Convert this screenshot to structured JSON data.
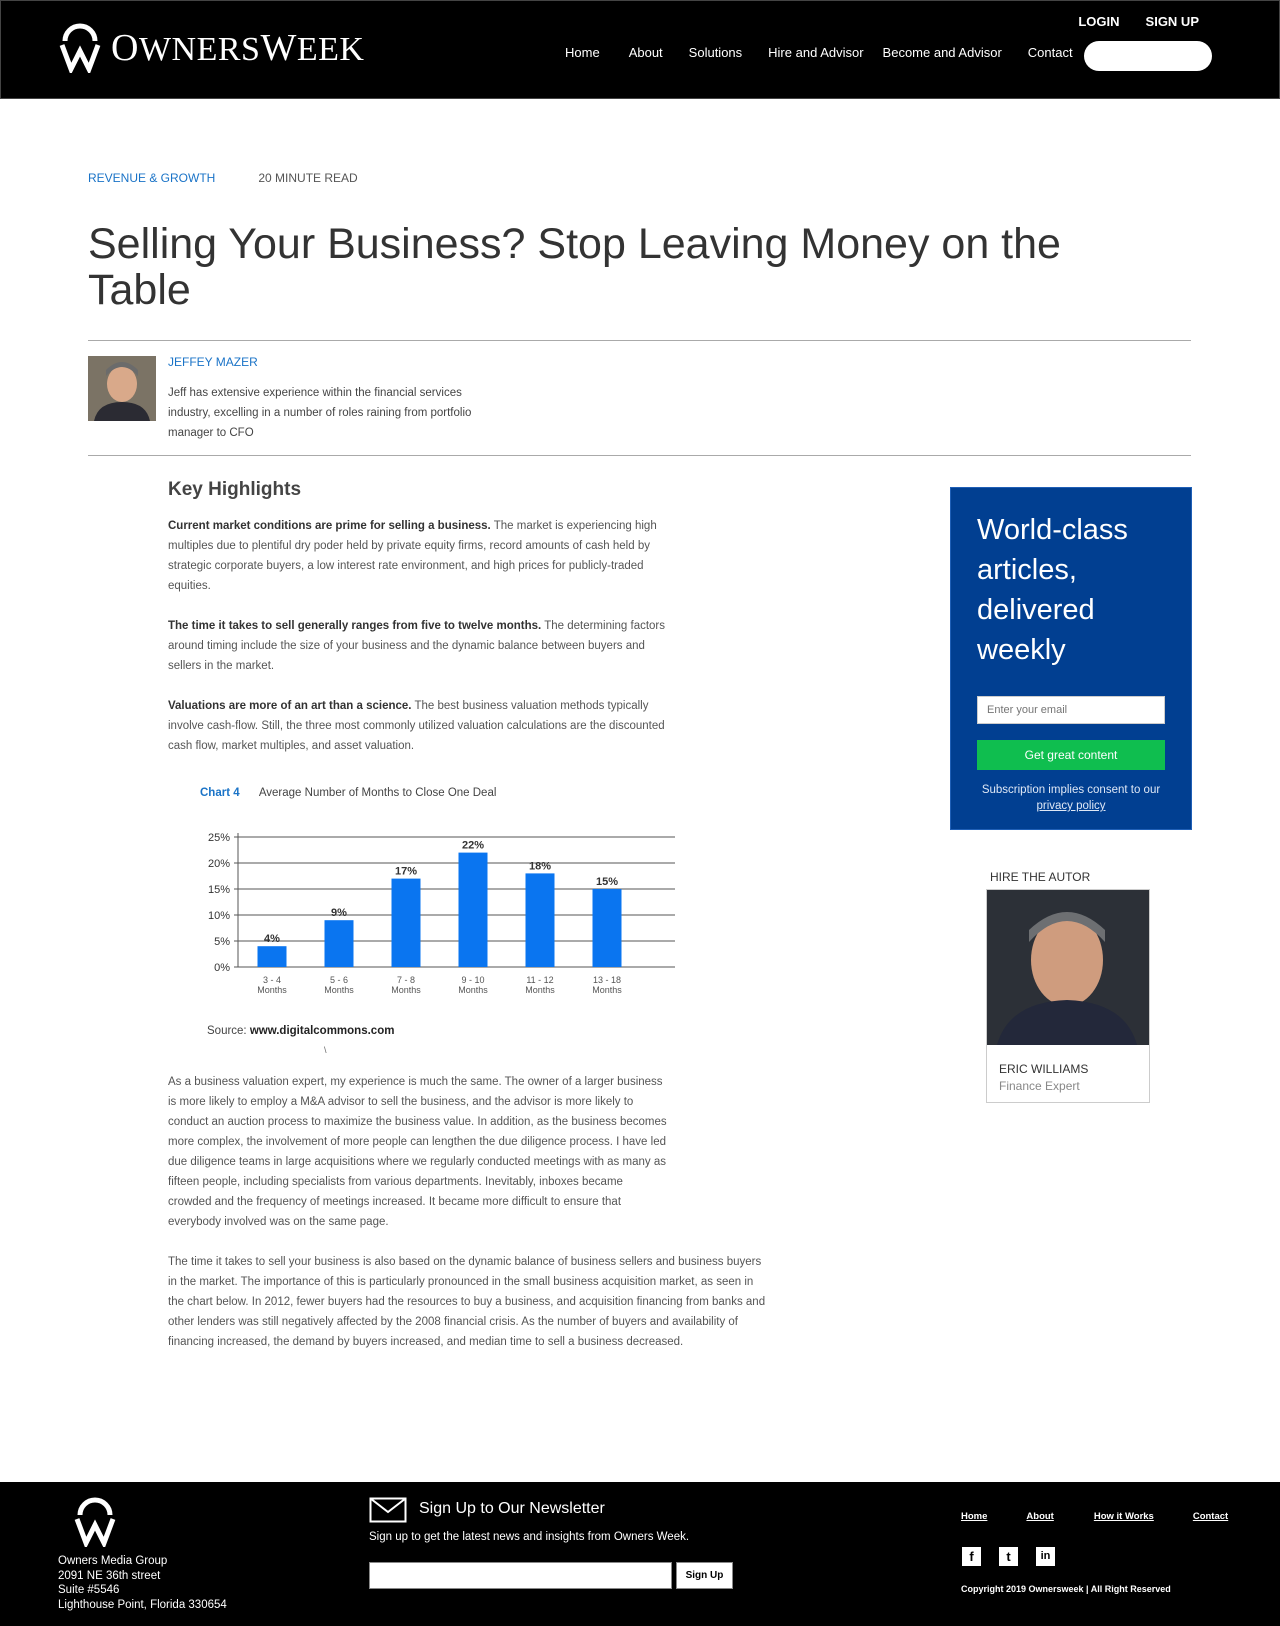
{
  "brand": {
    "name": "OwnersWeek",
    "name_part1": "O",
    "name_part2": "WNERS",
    "name_part3": "W",
    "name_part4": "EEK"
  },
  "header": {
    "login_label": "LOGIN",
    "signup_label": "SIGN UP",
    "nav": [
      "Home",
      "About",
      "Solutions",
      "Hire and Advisor",
      "Become and Advisor",
      "Contact"
    ],
    "search_value": ""
  },
  "article": {
    "category": "REVENUE & GROWTH",
    "read_time": "20 MINUTE READ",
    "title": "Selling Your Business? Stop Leaving Money on the Table",
    "author": {
      "name": "JEFFEY MAZER",
      "bio": "Jeff has extensive experience within the financial services industry, excelling in a number of roles raining from portfolio manager to CFO"
    },
    "key_highlights_heading": "Key Highlights",
    "highlights": [
      {
        "bold": "Current market conditions are prime for selling a business.",
        "text": " The market is experiencing high multiples due to plentiful dry poder held by private equity firms, record amounts of cash held by strategic corporate buyers, a low interest rate environment, and high prices for publicly-traded equities."
      },
      {
        "bold": "The time it takes to sell generally ranges from five to twelve months.",
        "text": "  The determining factors around timing include the size of your business and the dynamic balance between buyers and sellers in the market."
      },
      {
        "bold": "Valuations are more of an art than a science.",
        "text": " The best business valuation methods typically involve cash-flow. Still, the three most commonly utilized valuation calculations are the discounted cash flow, market multiples, and asset valuation."
      }
    ],
    "chart_number": "Chart 4",
    "chart_caption": "Average Number of Months to Close One Deal",
    "source_label": "Source: ",
    "source_url": "www.digitalcommons.com",
    "stray_mark": "\\",
    "body_paragraphs": [
      "As a business valuation expert, my experience is much the same. The owner of a larger business is more likely to employ a M&A advisor to sell the business, and the advisor is more likely to conduct an auction process to maximize the business value. In addition, as the business becomes more complex, the involvement of more people can lengthen the due diligence process. I have led due diligence teams in large acquisitions where we regularly conducted meetings with as many as fifteen people, including specialists from various departments. Inevitably, inboxes became crowded and the frequency of meetings increased. It became more difficult to ensure that everybody involved was on the same page.",
      "The time it takes to sell your business is also based on the dynamic balance of business sellers and business buyers in the market. The importance of this is particularly pronounced in the small business acquisition market, as seen in the chart below. In 2012, fewer buyers had the resources to buy a business, and acquisition financing from banks and other lenders was still negatively affected by the 2008 financial crisis. As the number of buyers and availability of financing increased, the demand by buyers increased, and median time to sell a business decreased."
    ]
  },
  "chart_data": {
    "type": "bar",
    "categories": [
      "3 - 4 Months",
      "5 - 6 Months",
      "7 - 8 Months",
      "9 - 10 Months",
      "11 - 12 Months",
      "13 - 18 Months"
    ],
    "category_lines": [
      [
        "3 - 4",
        "Months"
      ],
      [
        "5 - 6",
        "Months"
      ],
      [
        "7 - 8",
        "Months"
      ],
      [
        "9 - 10",
        "Months"
      ],
      [
        "11 - 12",
        "Months"
      ],
      [
        "13 - 18",
        "Months"
      ]
    ],
    "values": [
      4,
      9,
      17,
      22,
      18,
      15
    ],
    "value_labels": [
      "4%",
      "9%",
      "17%",
      "22%",
      "18%",
      "15%"
    ],
    "yticks": [
      "0%",
      "5%",
      "10%",
      "15%",
      "20%",
      "25%"
    ],
    "ylim": [
      0,
      25
    ],
    "grid": true,
    "bar_color": "#0a75f0"
  },
  "sidebar": {
    "cta_title": "World-class articles, delivered weekly",
    "email_placeholder": "Enter your email",
    "cta_button": "Get great content",
    "consent_text": "Subscription implies consent to our ",
    "privacy_link": "privacy policy",
    "hire_label": "HIRE THE AUTOR",
    "hire_name": "ERIC WILLIAMS",
    "hire_role": "Finance Expert"
  },
  "footer": {
    "address_lines": [
      "Owners Media Group",
      "2091 NE 36th street",
      "Suite #5546",
      "Lighthouse Point, Florida 330654"
    ],
    "newsletter_title": "Sign Up to Our Newsletter",
    "newsletter_sub": "Sign up to get the latest news and insights from Owners Week.",
    "newsletter_button": "Sign Up",
    "nav": [
      "Home",
      "About",
      "How it Works",
      "Contact"
    ],
    "socials": [
      {
        "icon": "facebook-icon",
        "glyph": "f"
      },
      {
        "icon": "twitter-icon",
        "glyph": "t"
      },
      {
        "icon": "linkedin-icon",
        "glyph": "in"
      }
    ],
    "copyright": "Copyright 2019 Ownersweek | All Right Reserved"
  },
  "colors": {
    "accent": "#1a73c7",
    "cta_bg": "#013f91",
    "cta_button": "#0fbe4f",
    "header_bg": "#000000"
  }
}
